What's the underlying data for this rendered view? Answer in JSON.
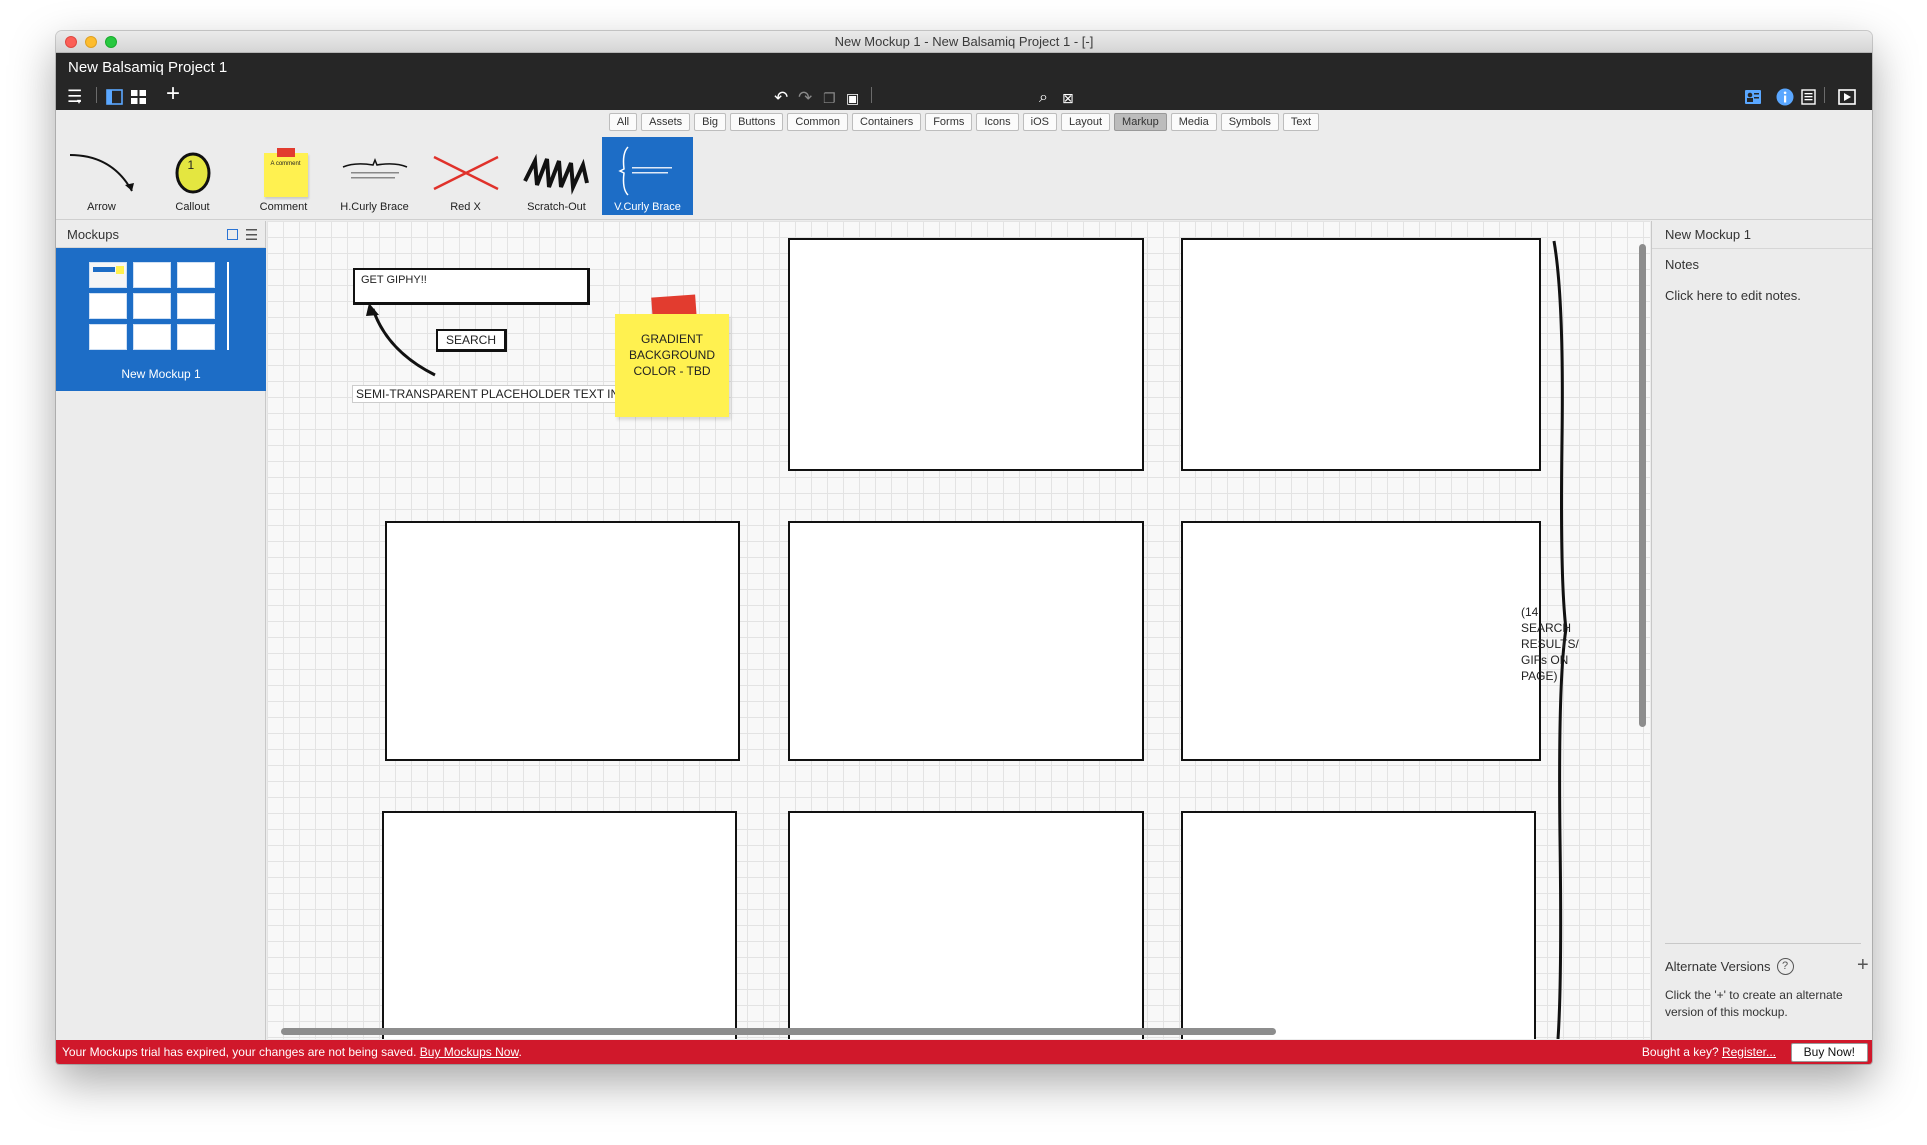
{
  "window": {
    "title": "New Mockup 1 - New Balsamiq Project 1 - [-]"
  },
  "header": {
    "project_title": "New Balsamiq Project 1",
    "icons": [
      "menu-icon",
      "single-view-icon",
      "grid-view-icon",
      "add-icon",
      "undo-icon",
      "redo-icon",
      "copy-icon",
      "paste-icon",
      "search-icon",
      "clipboard-icon",
      "account-icon",
      "info-icon",
      "document-icon",
      "play-icon"
    ]
  },
  "library_tabs": [
    "All",
    "Assets",
    "Big",
    "Buttons",
    "Common",
    "Containers",
    "Forms",
    "Icons",
    "iOS",
    "Layout",
    "Markup",
    "Media",
    "Symbols",
    "Text"
  ],
  "active_tab": "Markup",
  "components": [
    {
      "label": "Arrow"
    },
    {
      "label": "Callout",
      "number": "1"
    },
    {
      "label": "Comment",
      "sticky_text": "A comment"
    },
    {
      "label": "H.Curly Brace"
    },
    {
      "label": "Red X"
    },
    {
      "label": "Scratch-Out"
    },
    {
      "label": "V.Curly Brace"
    }
  ],
  "sidebar": {
    "title": "Mockups",
    "mockups": [
      {
        "name": "New Mockup 1"
      }
    ]
  },
  "canvas": {
    "input_text": "GET GIPHY!!",
    "search_label": "SEARCH",
    "placeholder_note": "SEMI-TRANSPARENT PLACEHOLDER TEXT IN CSS",
    "sticky_lines": [
      "GRADIENT",
      "BACKGROUND",
      "COLOR - TBD"
    ],
    "brace_note_lines": [
      "(14",
      "SEARCH",
      "RESULTS/",
      "GIFs ON",
      "PAGE)"
    ]
  },
  "right_panel": {
    "title": "New Mockup 1",
    "notes_label": "Notes",
    "notes_placeholder": "Click here to edit notes.",
    "alt_versions_label": "Alternate Versions",
    "help_symbol": "?",
    "plus_symbol": "+",
    "alt_versions_desc": "Click the '+' to create an alternate version of this mockup."
  },
  "trial_bar": {
    "message": "Your Mockups trial has expired, your changes are not being saved.",
    "buy_link": "Buy Mockups Now",
    "period": ".",
    "bought_text": "Bought a key?",
    "register_link": "Register...",
    "buy_button": "Buy Now!"
  },
  "colors": {
    "selection_blue": "#1d6dc6",
    "trial_red": "#d0182b",
    "sticky_yellow": "#fff150",
    "tape_red": "#e23c2f"
  }
}
